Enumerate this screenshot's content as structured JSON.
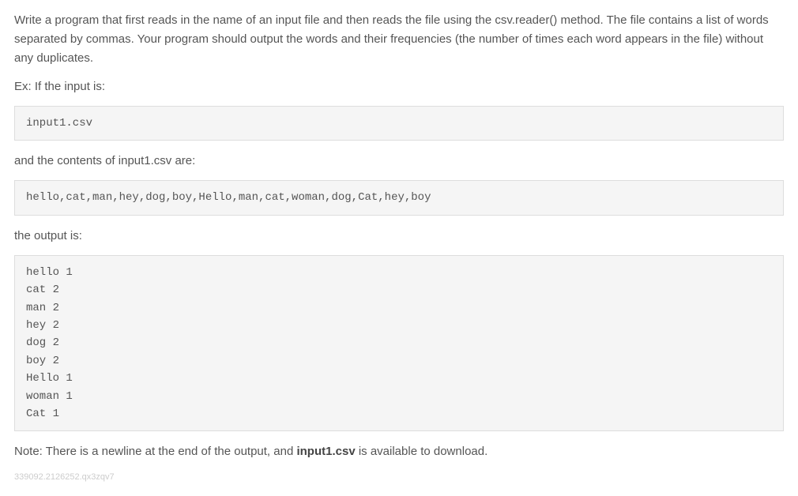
{
  "para1": "Write a program that first reads in the name of an input file and then reads the file using the csv.reader() method. The file contains a list of words separated by commas. Your program should output the words and their frequencies (the number of times each word appears in the file) without any duplicates.",
  "para2": "Ex: If the input is:",
  "code1": "input1.csv",
  "para3": "and the contents of input1.csv are:",
  "code2": "hello,cat,man,hey,dog,boy,Hello,man,cat,woman,dog,Cat,hey,boy",
  "para4": "the output is:",
  "code3": "hello 1\ncat 2\nman 2\nhey 2\ndog 2\nboy 2\nHello 1\nwoman 1\nCat 1",
  "note_prefix": "Note: There is a newline at the end of the output, and ",
  "note_bold": "input1.csv",
  "note_suffix": " is available to download.",
  "watermark": "339092.2126252.qx3zqv7"
}
